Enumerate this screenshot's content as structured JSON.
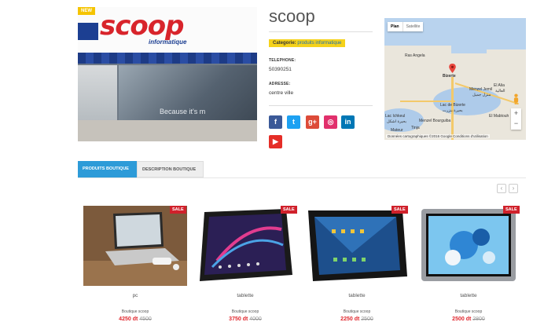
{
  "shop": {
    "badge": "NEW",
    "photo_logo": "scoop",
    "photo_logo_sub": "informatique",
    "photo_window_text": "Because it's m",
    "name": "scoop",
    "category_key": "Categorie:",
    "category_value": "produits informatique",
    "phone_label": "TELEPHONE:",
    "phone_value": "50390251",
    "address_label": "ADRESSE:",
    "address_value": "centre ville"
  },
  "social": [
    {
      "name": "facebook",
      "glyph": "f",
      "color": "#3b5998"
    },
    {
      "name": "twitter",
      "glyph": "t",
      "color": "#1da1f2"
    },
    {
      "name": "google-plus",
      "glyph": "g+",
      "color": "#dd4b39"
    },
    {
      "name": "instagram",
      "glyph": "◎",
      "color": "#e1306c"
    },
    {
      "name": "linkedin",
      "glyph": "in",
      "color": "#0077b5"
    },
    {
      "name": "youtube",
      "glyph": "▶",
      "color": "#e52d27"
    }
  ],
  "map": {
    "tab_plan": "Plan",
    "tab_satellite": "Satellite",
    "labels": {
      "ras_angela": "Ras Angela",
      "bizerte": "Bizerte",
      "menzel_jemil": "Menzel Jemil",
      "menzel_jemil_ar": "منزل جميل",
      "el_alia": "El Alia",
      "el_alia_ar": "العالية",
      "lac_de_bizerte": "Lac de Bizerte",
      "lac_de_bizerte_ar": "بحيرة بنزرت",
      "lac_ichkeul": "Lac Ichkeul",
      "lac_ichkeul_ar": "بحيرة اشكل",
      "menzel_bourguiba": "Menzel Bourguiba",
      "el_mabtouh": "El Mabtouh",
      "tinja": "Tinja",
      "mateur": "Mateur"
    },
    "zoom_in": "+",
    "zoom_out": "−",
    "footer": "Données cartographiques ©2016 Google   Conditions d'utilisation"
  },
  "tabs": {
    "products": "PRODUITS BOUTIQUE",
    "description": "DESCRIPTION BOUTIQUE"
  },
  "nav": {
    "prev": "‹",
    "next": "›"
  },
  "products": [
    {
      "badge": "SALE",
      "name": "pc",
      "shop": "Boutique scoop",
      "price": "4250 dt",
      "old_price": "4500"
    },
    {
      "badge": "SALE",
      "name": "tablette",
      "shop": "Boutique scoop",
      "price": "3750 dt",
      "old_price": "4000"
    },
    {
      "badge": "SALE",
      "name": "tablette",
      "shop": "Boutique scoop",
      "price": "2250 dt",
      "old_price": "2500"
    },
    {
      "badge": "SALE",
      "name": "tablette",
      "shop": "Boutique scoop",
      "price": "2500 dt",
      "old_price": "2800"
    }
  ]
}
